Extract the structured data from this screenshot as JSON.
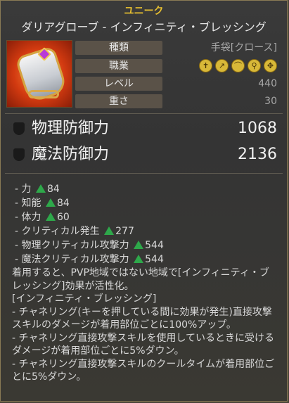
{
  "header": {
    "rarity": "ユニーク",
    "item_name": "ダリアグローブ - インフィニティ・ブレッシング"
  },
  "info": {
    "type_label": "種類",
    "type_value": "手袋[クロース]",
    "class_label": "職業",
    "class_icons": [
      "sword-class-icon",
      "dagger-class-icon",
      "bow-class-icon",
      "staff-class-icon",
      "cross-class-icon"
    ],
    "level_label": "レベル",
    "level_value": "440",
    "weight_label": "重さ",
    "weight_value": "30"
  },
  "defense": {
    "physical_label": "物理防御力",
    "physical_value": "1068",
    "magic_label": "魔法防御力",
    "magic_value": "2136"
  },
  "stats": [
    {
      "label": "- 力",
      "value": "84"
    },
    {
      "label": "- 知能",
      "value": "84"
    },
    {
      "label": "- 体力",
      "value": "60"
    },
    {
      "label": "- クリティカル発生",
      "value": "277"
    },
    {
      "label": "- 物理クリティカル攻撃力",
      "value": "544"
    },
    {
      "label": "- 魔法クリティカル攻撃力",
      "value": "544"
    }
  ],
  "description": [
    "着用すると、PVP地域ではない地域で[インフィニティ・ブレッシング]効果が活性化。",
    "[インフィニティ・ブレッシング]",
    "- チャネリング(キーを押している間に効果が発生)直接攻撃スキルのダメージが着用部位ごとに100%アップ。",
    "- チャネリング直接攻撃スキルを使用しているときに受けるダメージが着用部位ごとに5%ダウン。",
    "- チャネリング直接攻撃スキルのクールタイムが着用部位ごとに5%ダウン。"
  ],
  "colors": {
    "rarity": "#e8c030",
    "increase_arrow": "#2ea84a"
  }
}
